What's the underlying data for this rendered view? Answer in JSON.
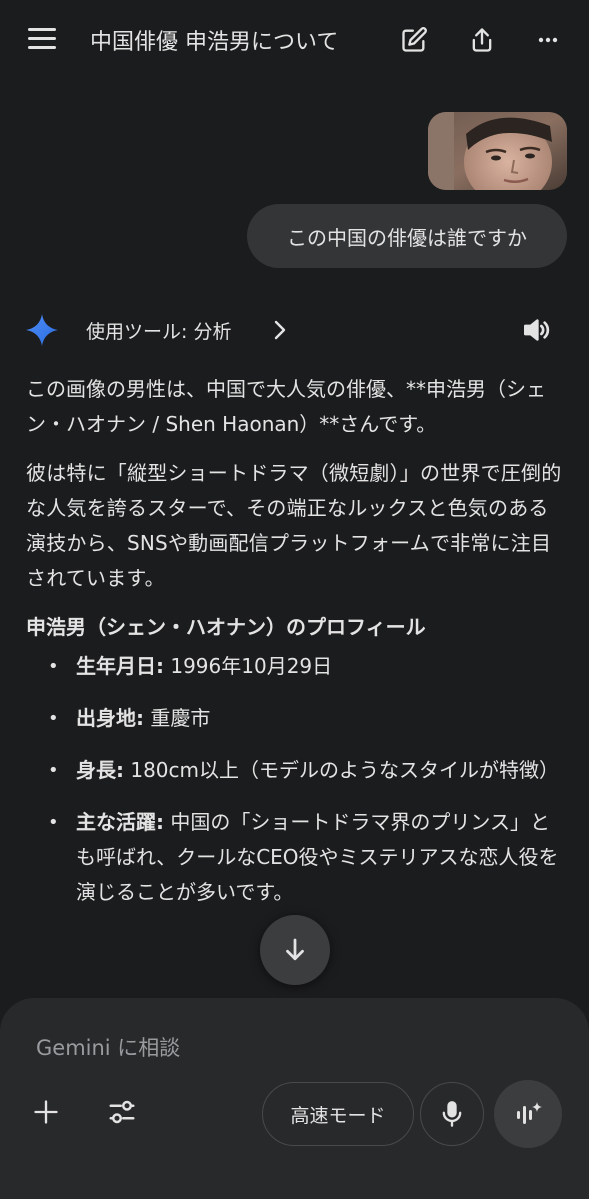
{
  "header": {
    "title": "中国俳優 申浩男について",
    "icons": [
      "menu-icon",
      "edit-icon",
      "share-icon",
      "more-icon"
    ]
  },
  "user_message": {
    "image_alt": "photo of a man",
    "text": "この中国の俳優は誰ですか"
  },
  "tool_status": {
    "label": "使用ツール: 分析",
    "icons": [
      "gemini-spark-icon",
      "chevron-right-icon",
      "speaker-icon"
    ]
  },
  "answer": {
    "para1": "この画像の男性は、中国で大人気の俳優、**申浩男（シェン・ハオナン / Shen Haonan）**さんです。",
    "para2": "彼は特に「縦型ショートドラマ（微短劇）」の世界で圧倒的な人気を誇るスターで、その端正なルックスと色気のある演技から、SNSや動画配信プラットフォームで非常に注目されています。",
    "section_title": "申浩男（シェン・ハオナン）のプロフィール",
    "profile": [
      {
        "label": "生年月日:",
        "value": " 1996年10月29日"
      },
      {
        "label": "出身地:",
        "value": " 重慶市"
      },
      {
        "label": "身長:",
        "value": " 180cm以上（モデルのようなスタイルが特徴）"
      },
      {
        "label": "主な活躍:",
        "value": " 中国の「ショートドラマ界のプリンス」とも呼ばれ、クールなCEO役やミステリアスな恋人役を演じることが多いです。"
      }
    ]
  },
  "composer": {
    "placeholder": "Gemini に相談",
    "mode_label": "高速モード",
    "icons": [
      "plus-icon",
      "tools-icon",
      "mic-icon",
      "live-icon",
      "arrow-down-icon"
    ]
  },
  "colors": {
    "background": "#1b1c1d",
    "bubble": "#333537",
    "composer": "#28292b",
    "text": "#e3e3e3",
    "placeholder": "#9a9b9e",
    "gemini_blue": "#4f8df7"
  }
}
